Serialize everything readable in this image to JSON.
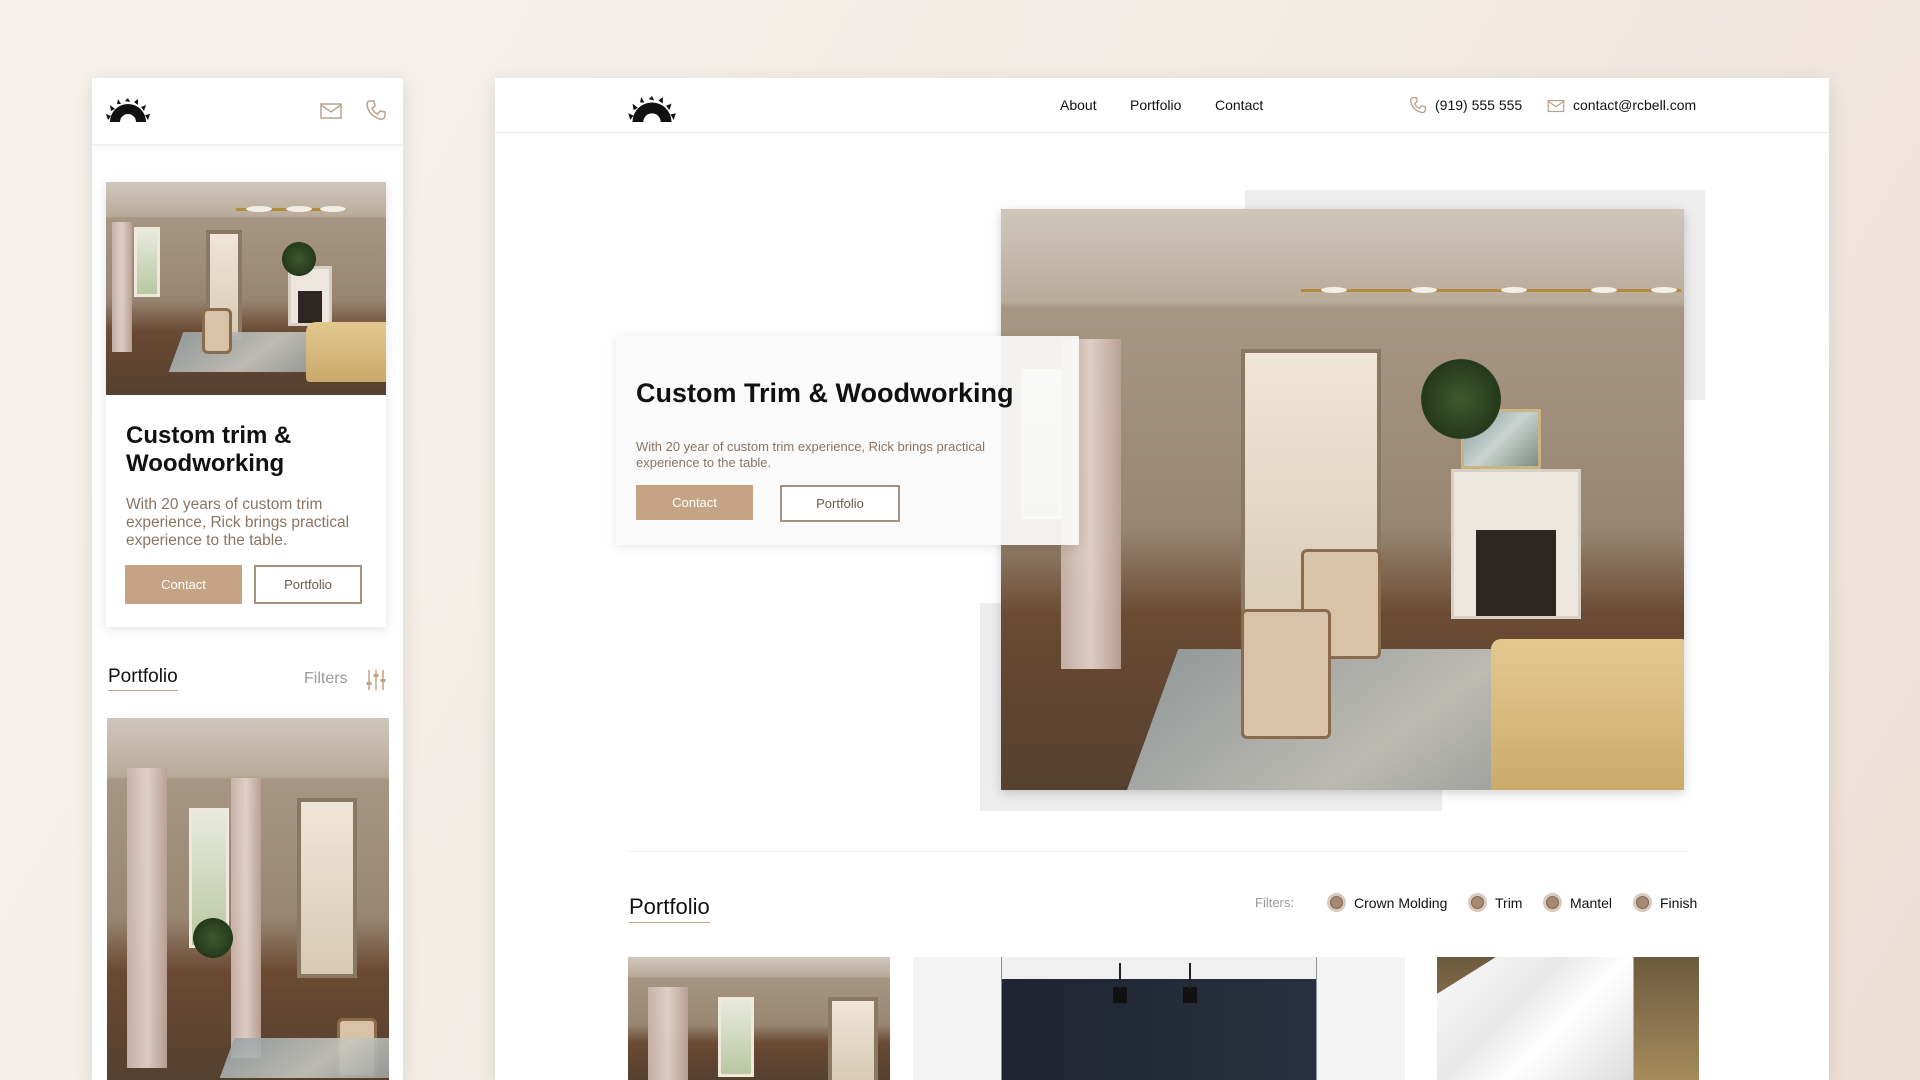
{
  "brand": {
    "logo_icon": "saw-blade-icon",
    "accent": "#c4a484",
    "text_muted": "#8a7563"
  },
  "mobile": {
    "header": {
      "mail_icon": "mail-icon",
      "phone_icon": "phone-icon"
    },
    "hero": {
      "title": "Custom trim & Woodworking",
      "description": "With 20 years of custom trim experience, Rick brings practical experience to the table.",
      "contact_label": "Contact",
      "portfolio_label": "Portfolio"
    },
    "portfolio": {
      "title": "Portfolio",
      "filters_label": "Filters",
      "filters_icon": "sliders-icon"
    }
  },
  "desktop": {
    "nav": {
      "items": [
        "About",
        "Portfolio",
        "Contact"
      ],
      "phone": "(919) 555 555",
      "email": "contact@rcbell.com"
    },
    "hero": {
      "title": "Custom Trim & Woodworking",
      "description": "With 20 year of custom trim experience, Rick brings practical experience to the table.",
      "contact_label": "Contact",
      "portfolio_label": "Portfolio"
    },
    "portfolio": {
      "title": "Portfolio",
      "filters_label": "Filters:",
      "filters": [
        "Crown Molding",
        "Trim",
        "Mantel",
        "Finish"
      ]
    }
  }
}
